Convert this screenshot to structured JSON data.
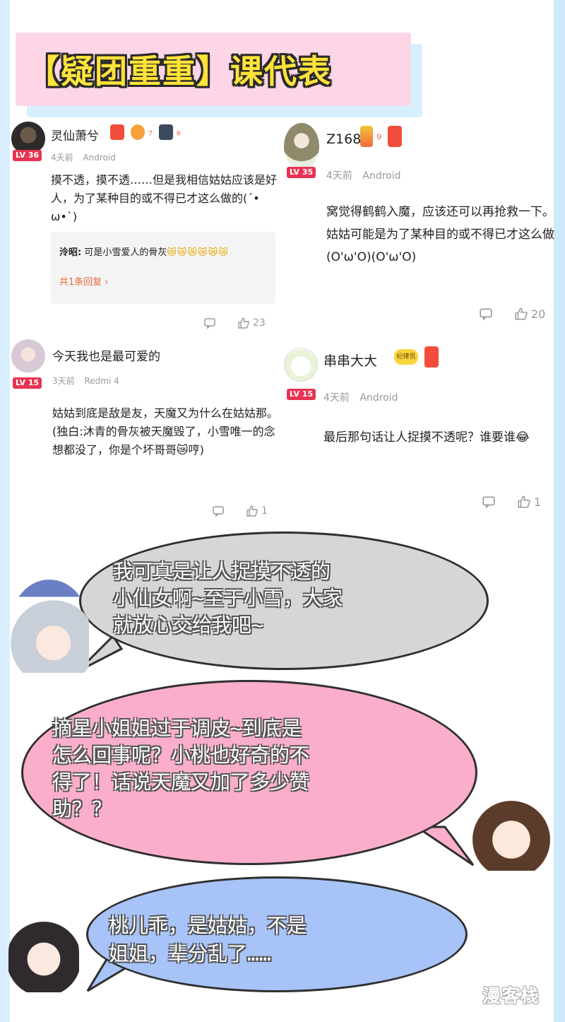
{
  "banner": {
    "title": "【疑团重重】课代表"
  },
  "comments": [
    {
      "username": "灵仙萧兮",
      "level": "LV 36",
      "time": "4天前",
      "device": "Android",
      "text_lines": [
        "摸不透，摸不透……但是我相信姑姑应该是好",
        "人，为了某种目的或不得已才这么做的(´•",
        "ω•`)"
      ],
      "reply": {
        "author": "泠昭:",
        "text": "可是小雪爱人的骨灰",
        "emojis": "😿😿😿😿😿😿",
        "count_label": "共1条回复 ›"
      },
      "likes": "23",
      "medal_numbers": [
        "7",
        "6"
      ]
    },
    {
      "username": "Z168",
      "level": "LV 35",
      "time": "4天前",
      "device": "Android",
      "text_lines": [
        "窝觉得鹤鹤入魔，应该还可以再抢救一下。",
        "姑姑可能是为了某种目的或不得已才这么做",
        "(O'ω'O)(O'ω'O)"
      ],
      "likes": "20",
      "medal_numbers": [
        "9"
      ]
    },
    {
      "username": "今天我也是最可爱的",
      "level": "LV 15",
      "time": "3天前",
      "device": "Redmi 4",
      "text_lines": [
        "姑姑到底是敌是友，天魔又为什么在姑姑那。",
        "(独白:沐青的骨灰被天魔毁了，小雪唯一的念",
        "想都没了，你是个坏哥哥😿哼)"
      ],
      "likes": "1"
    },
    {
      "username": "串串大大",
      "level": "LV 15",
      "time": "4天前",
      "device": "Android",
      "badge": "纪律员",
      "text_lines": [
        "最后那句话让人捉摸不透呢？谁要谁😂"
      ],
      "likes": "1"
    }
  ],
  "bubbles": [
    {
      "lines": [
        "我可真是让人捉摸不透的",
        "小仙女啊~至于小雪，大家",
        "就放心交给我吧~"
      ],
      "color": "#d6d6d6"
    },
    {
      "lines": [
        "摘星小姐姐过于调皮~到底是",
        "怎么回事呢？小桃也好奇的不",
        "得了！话说天魔又加了多少赞",
        "助？？"
      ],
      "color": "#fbaecb"
    },
    {
      "lines": [
        "桃儿乖，是姑姑，不是",
        "姐姐，辈分乱了……"
      ],
      "color": "#a7c3f7"
    }
  ],
  "watermark": "漫客栈"
}
